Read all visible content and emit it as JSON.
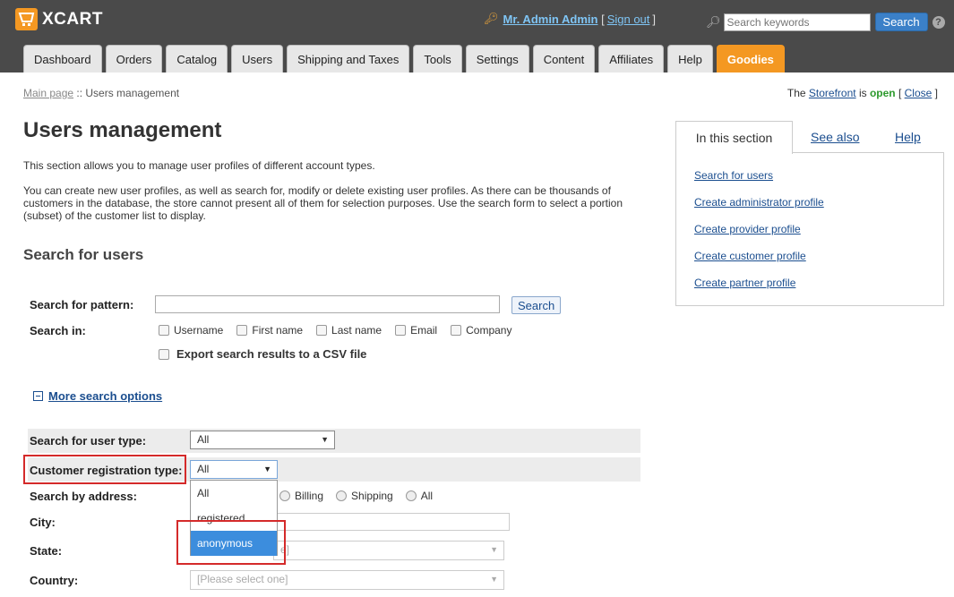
{
  "header": {
    "logo": "XCART",
    "user_name": "Mr. Admin Admin",
    "sign_out": "Sign out",
    "search_placeholder": "Search keywords",
    "search_button": "Search",
    "help": "?"
  },
  "tabs": [
    "Dashboard",
    "Orders",
    "Catalog",
    "Users",
    "Shipping and Taxes",
    "Tools",
    "Settings",
    "Content",
    "Affiliates",
    "Help",
    "Goodies"
  ],
  "breadcrumb": {
    "main": "Main page",
    "sep": " :: ",
    "current": "Users management"
  },
  "storefront": {
    "prefix": "The ",
    "link": "Storefront",
    "is": " is ",
    "status": "open",
    "close": "Close"
  },
  "page": {
    "title": "Users management",
    "desc1": "This section allows you to manage user profiles of different account types.",
    "desc2": "You can create new user profiles, as well as search for, modify or delete existing user profiles. As there can be thousands of customers in the database, the store cannot present all of them for selection purposes. Use the search form to select a portion (subset) of the customer list to display.",
    "section_title": "Search for users"
  },
  "side": {
    "tabs": [
      "In this section",
      "See also",
      "Help"
    ],
    "links": [
      "Search for users",
      "Create administrator profile",
      "Create provider profile",
      "Create customer profile",
      "Create partner profile"
    ]
  },
  "form": {
    "pattern_label": "Search for pattern:",
    "search_button": "Search",
    "search_in_label": "Search in:",
    "search_in": [
      "Username",
      "First name",
      "Last name",
      "Email",
      "Company"
    ],
    "export_label": "Export search results to a CSV file",
    "more_options": "More search options",
    "user_type_label": "Search for user type:",
    "user_type_value": "All",
    "reg_type_label": "Customer registration type:",
    "reg_type_value": "All",
    "reg_type_options": [
      "All",
      "registered",
      "anonymous"
    ],
    "address_label": "Search by address:",
    "address_options": [
      "Billing",
      "Shipping",
      "All"
    ],
    "city_label": "City:",
    "state_label": "State:",
    "country_label": "Country:",
    "country_placeholder": "[Please select one]",
    "state_placeholder_tail": "e]"
  }
}
